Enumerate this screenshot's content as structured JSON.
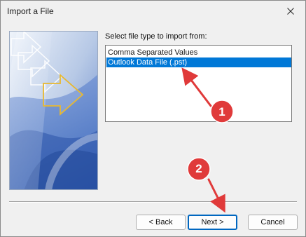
{
  "window": {
    "title": "Import a File"
  },
  "dialog": {
    "prompt": "Select file type to import from:",
    "file_types": [
      {
        "label": "Comma Separated Values",
        "selected": false
      },
      {
        "label": "Outlook Data File (.pst)",
        "selected": true
      }
    ]
  },
  "buttons": {
    "back": "< Back",
    "next": "Next >",
    "cancel": "Cancel"
  },
  "annotations": {
    "step_1": "1",
    "step_2": "2"
  },
  "colors": {
    "selection": "#0078d7",
    "annotation": "#e03a3a",
    "default_button_border": "#0067c0"
  },
  "icons": {
    "close": "close-icon",
    "wizard_graphic": "import-wizard-graphic"
  }
}
